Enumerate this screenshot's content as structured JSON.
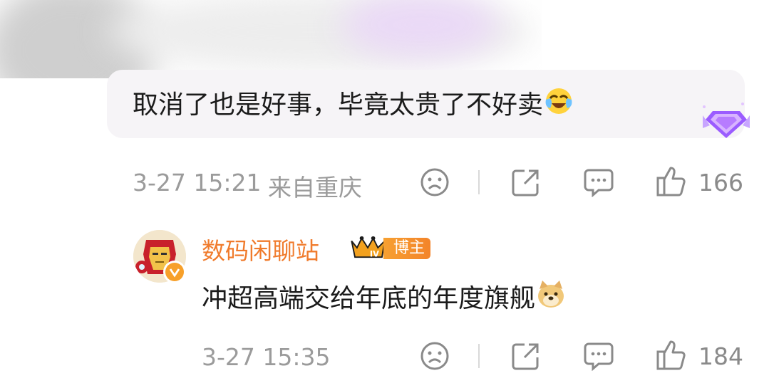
{
  "comment": {
    "text": "取消了也是好事，毕竟太贵了不好卖",
    "emoji_icon": "laugh-cry-emoji",
    "badge_icon": "purple-gem-badge-icon",
    "timestamp": "3-27 15:21",
    "location": "来自重庆",
    "like_count": "166"
  },
  "reply": {
    "username": "数码闲聊站",
    "level_badge": "IV",
    "role_label": "博主",
    "text": "冲超高端交给年底的年度旗舰",
    "emoji_icon": "doge-emoji",
    "timestamp": "3-27 15:35",
    "like_count": "184"
  },
  "colors": {
    "username": "#f07b2c",
    "badge_orange": "#f3842a",
    "meta_gray": "#9b9b9b"
  }
}
